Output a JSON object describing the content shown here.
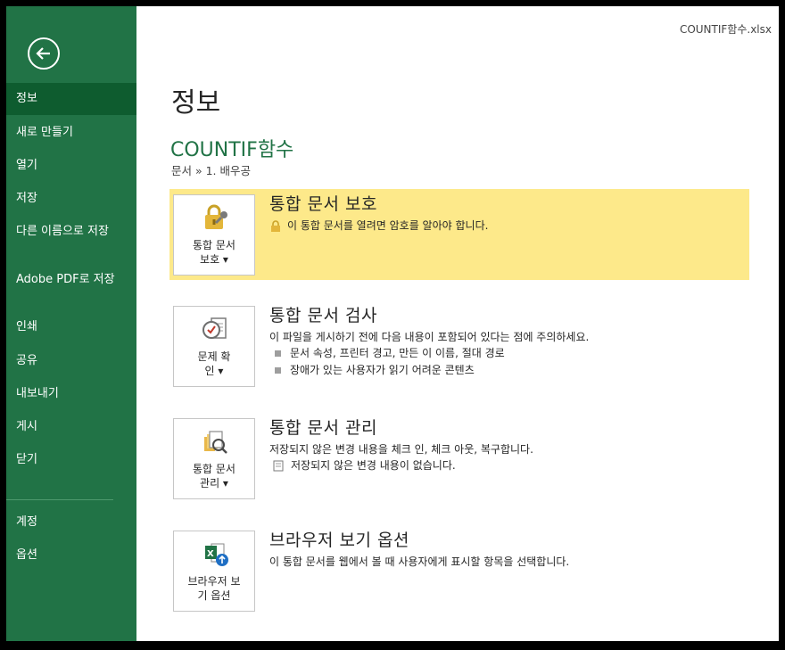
{
  "window": {
    "file_title": "COUNTIF함수.xlsx"
  },
  "sidebar": {
    "items": [
      {
        "label": "정보"
      },
      {
        "label": "새로 만들기"
      },
      {
        "label": "열기"
      },
      {
        "label": "저장"
      },
      {
        "label": "다른 이름으로 저장"
      },
      {
        "label": "Adobe PDF로 저장"
      },
      {
        "label": "인쇄"
      },
      {
        "label": "공유"
      },
      {
        "label": "내보내기"
      },
      {
        "label": "게시"
      },
      {
        "label": "닫기"
      }
    ],
    "bottom_items": [
      {
        "label": "계정"
      },
      {
        "label": "옵션"
      }
    ],
    "active": "정보"
  },
  "main": {
    "page_title": "정보",
    "doc_name": "COUNTIF함수",
    "breadcrumb": "문서 » 1. 배우공",
    "sections": {
      "protect": {
        "button_label": "통합 문서 보호 ▾",
        "title": "통합 문서 보호",
        "desc": "이 통합 문서를 열려면 암호를 알아야 합니다."
      },
      "inspect": {
        "button_label": "문제 확인 ▾",
        "title": "통합 문서 검사",
        "desc": "이 파일을 게시하기 전에 다음 내용이 포함되어 있다는 점에 주의하세요.",
        "bullets": [
          "문서 속성, 프린터 경고, 만든 이 이름, 절대 경로",
          "장애가 있는 사용자가 읽기 어려운 콘텐츠"
        ]
      },
      "manage": {
        "button_label": "통합 문서 관리 ▾",
        "title": "통합 문서 관리",
        "desc": "저장되지 않은 변경 내용을 체크 인, 체크 아웃, 복구합니다.",
        "note": "저장되지 않은 변경 내용이 없습니다."
      },
      "browser": {
        "button_label": "브라우저 보기 옵션",
        "title": "브라우저 보기 옵션",
        "desc": "이 통합 문서를 웹에서 볼 때 사용자에게 표시할 항목을 선택합니다."
      }
    }
  },
  "colors": {
    "accent": "#217346",
    "active_nav": "#0e5c2f",
    "highlight": "#fde98a"
  },
  "icons": [
    "back-arrow-icon",
    "lock-key-icon",
    "inspect-document-icon",
    "manage-versions-icon",
    "excel-browser-icon",
    "document-icon"
  ]
}
